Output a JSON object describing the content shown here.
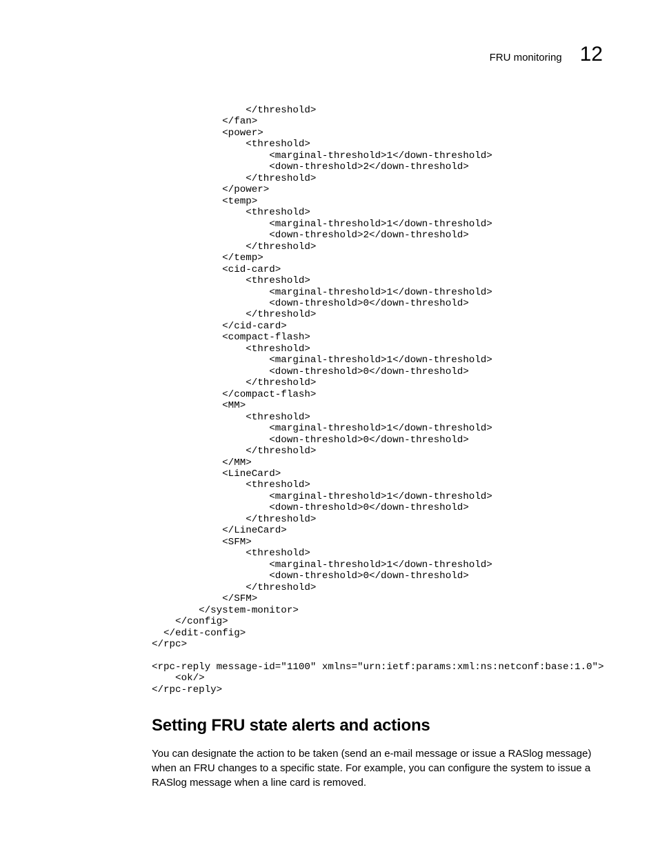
{
  "header": {
    "section_title": "FRU monitoring",
    "chapter_number": "12"
  },
  "code_block": "                </threshold>\n            </fan>\n            <power>\n                <threshold>\n                    <marginal-threshold>1</down-threshold>\n                    <down-threshold>2</down-threshold>\n                </threshold>\n            </power>\n            <temp>\n                <threshold>\n                    <marginal-threshold>1</down-threshold>\n                    <down-threshold>2</down-threshold>\n                </threshold>\n            </temp>\n            <cid-card>\n                <threshold>\n                    <marginal-threshold>1</down-threshold>\n                    <down-threshold>0</down-threshold>\n                </threshold>\n            </cid-card>\n            <compact-flash>\n                <threshold>\n                    <marginal-threshold>1</down-threshold>\n                    <down-threshold>0</down-threshold>\n                </threshold>\n            </compact-flash>\n            <MM>\n                <threshold>\n                    <marginal-threshold>1</down-threshold>\n                    <down-threshold>0</down-threshold>\n                </threshold>\n            </MM>\n            <LineCard>\n                <threshold>\n                    <marginal-threshold>1</down-threshold>\n                    <down-threshold>0</down-threshold>\n                </threshold>\n            </LineCard>\n            <SFM>\n                <threshold>\n                    <marginal-threshold>1</down-threshold>\n                    <down-threshold>0</down-threshold>\n                </threshold>\n            </SFM>\n        </system-monitor>\n    </config>\n  </edit-config>\n</rpc>\n\n<rpc-reply message-id=\"1100\" xmlns=\"urn:ietf:params:xml:ns:netconf:base:1.0\">\n    <ok/>\n</rpc-reply>",
  "section": {
    "heading": "Setting FRU state alerts and actions",
    "body": "You can designate the action to be taken (send an e-mail message or issue a RASlog message) when an FRU changes to a specific state. For example, you can configure the system to issue a RASlog message when a line card is removed."
  }
}
